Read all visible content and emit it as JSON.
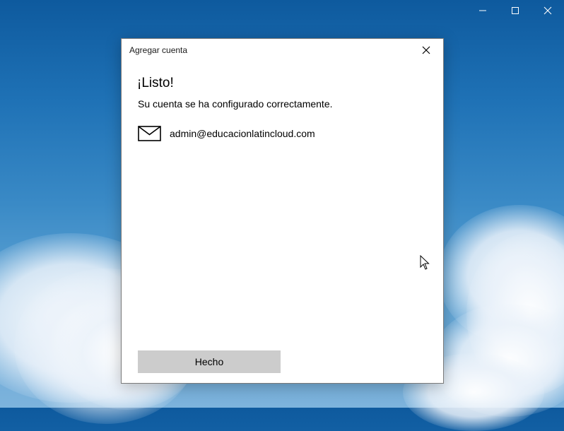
{
  "dialog": {
    "title": "Agregar cuenta",
    "heading": "¡Listo!",
    "message": "Su cuenta se ha configurado correctamente.",
    "account_email": "admin@educacionlatincloud.com",
    "done_button_label": "Hecho"
  },
  "icons": {
    "mail": "mail-icon",
    "close": "close-icon",
    "minimize": "minimize-icon",
    "maximize": "maximize-icon",
    "cursor": "mouse-pointer-icon"
  },
  "colors": {
    "dialog_background": "#ffffff",
    "button_background": "#cccccc",
    "sky_top": "#0e5a9e",
    "sky_bottom": "#7db3dc"
  }
}
